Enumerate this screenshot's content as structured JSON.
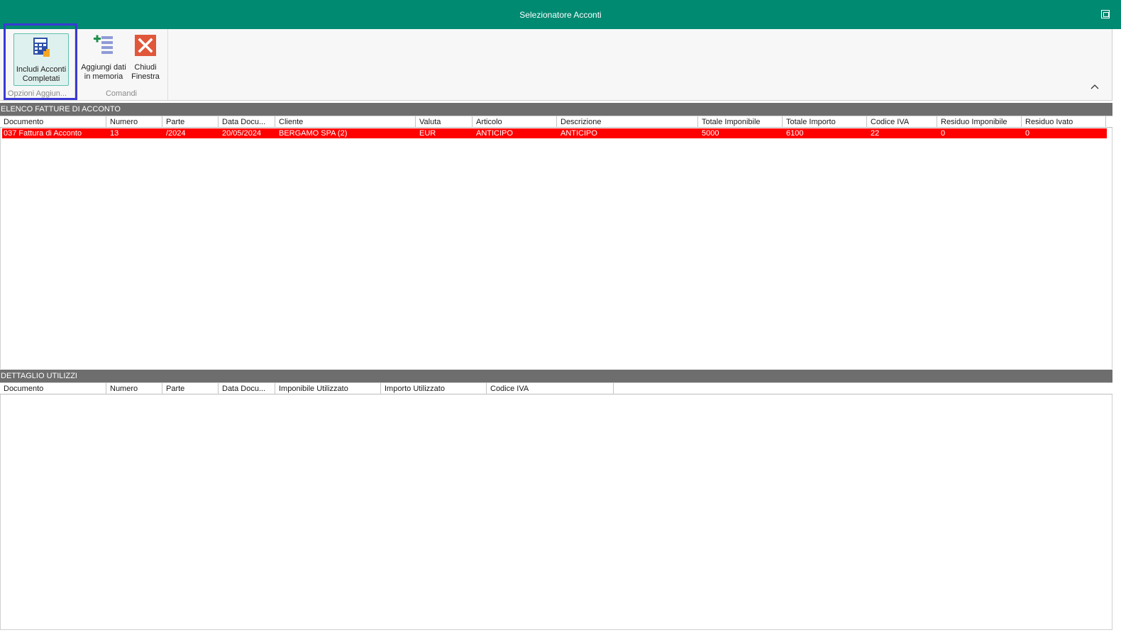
{
  "window": {
    "title": "Selezionatore Acconti"
  },
  "ribbon": {
    "groups": [
      {
        "label": "Opzioni Aggiun..."
      },
      {
        "label": "Comandi"
      }
    ],
    "buttons": {
      "includi_line1": "Includi Acconti",
      "includi_line2": "Completati",
      "aggiungi_line1": "Aggiungi dati",
      "aggiungi_line2": "in memoria",
      "chiudi_line1": "Chiudi",
      "chiudi_line2": "Finestra"
    }
  },
  "elenco": {
    "title": "ELENCO FATTURE DI ACCONTO",
    "columns": [
      "Documento",
      "Numero",
      "Parte",
      "Data Docu...",
      "Cliente",
      "Valuta",
      "Articolo",
      "Descrizione",
      "Totale Imponibile",
      "Totale Importo",
      "Codice IVA",
      "Residuo Imponibile",
      "Residuo Ivato"
    ],
    "rows": [
      [
        "037 Fattura di Acconto",
        "13",
        "/2024",
        "20/05/2024",
        "BERGAMO SPA (2)",
        "EUR",
        "ANTICIPO",
        "ANTICIPO",
        "5000",
        "6100",
        "22",
        "0",
        "0"
      ]
    ]
  },
  "dettaglio": {
    "title": "DETTAGLIO UTILIZZI",
    "columns": [
      "Documento",
      "Numero",
      "Parte",
      "Data Docu...",
      "Imponibile Utilizzato",
      "Importo Utilizzato",
      "Codice IVA"
    ]
  },
  "colors": {
    "titlebar": "#008a72",
    "selected_row": "#ff0000",
    "section_header": "#6e6e6e",
    "highlight": "#3a3ad4"
  }
}
